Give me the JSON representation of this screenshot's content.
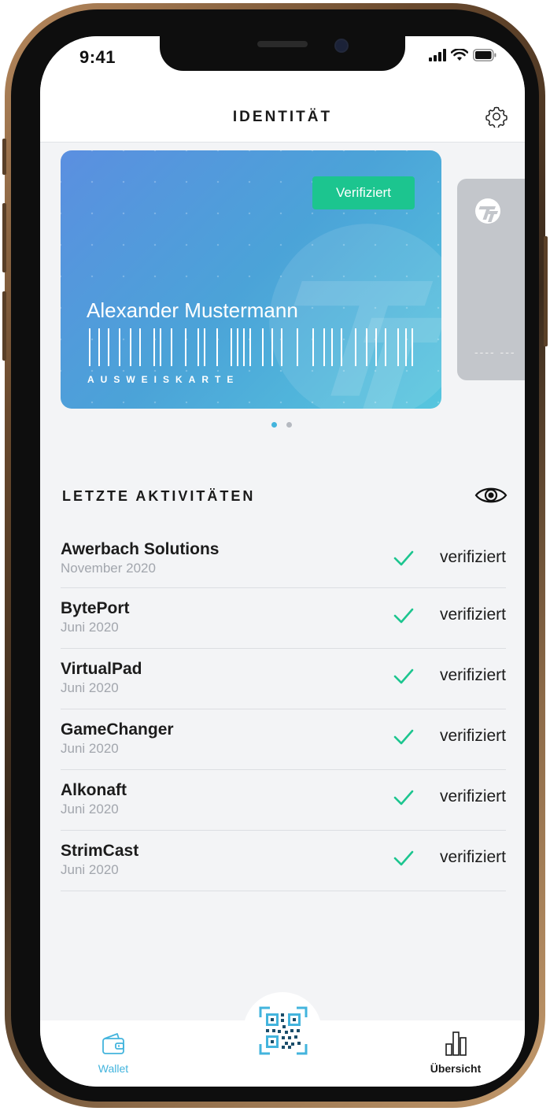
{
  "status_bar": {
    "time": "9:41"
  },
  "header": {
    "title": "IDENTITÄT"
  },
  "cards": {
    "main": {
      "badge": "Verifiziert",
      "holder_name": "Alexander Mustermann",
      "card_type": "AUSWEISKARTE"
    },
    "second": {
      "dashes": "---- ---"
    }
  },
  "pager": {
    "count": 2,
    "active_index": 0
  },
  "activities": {
    "title": "LETZTE AKTIVITÄTEN",
    "items": [
      {
        "name": "Awerbach Solutions",
        "date": "November 2020",
        "status": "verifiziert"
      },
      {
        "name": "BytePort",
        "date": "Juni 2020",
        "status": "verifiziert"
      },
      {
        "name": "VirtualPad",
        "date": "Juni 2020",
        "status": "verifiziert"
      },
      {
        "name": "GameChanger",
        "date": "Juni 2020",
        "status": "verifiziert"
      },
      {
        "name": "Alkonaft",
        "date": "Juni 2020",
        "status": "verifiziert"
      },
      {
        "name": "StrimCast",
        "date": "Juni 2020",
        "status": "verifiziert"
      }
    ]
  },
  "tabbar": {
    "wallet_label": "Wallet",
    "overview_label": "Übersicht"
  },
  "icons": {
    "settings": "gear-icon",
    "eye": "eye-icon",
    "check": "checkmark-icon",
    "qr": "qr-code-icon",
    "wallet": "wallet-icon",
    "overview": "bar-chart-icon"
  },
  "colors": {
    "accent": "#43b4dd",
    "verified_green": "#1cc58f",
    "check_green": "#1cc58f",
    "card_gradient_start": "#5b8fe0",
    "card_gradient_end": "#56c6de",
    "second_card": "#c3c6cb"
  }
}
